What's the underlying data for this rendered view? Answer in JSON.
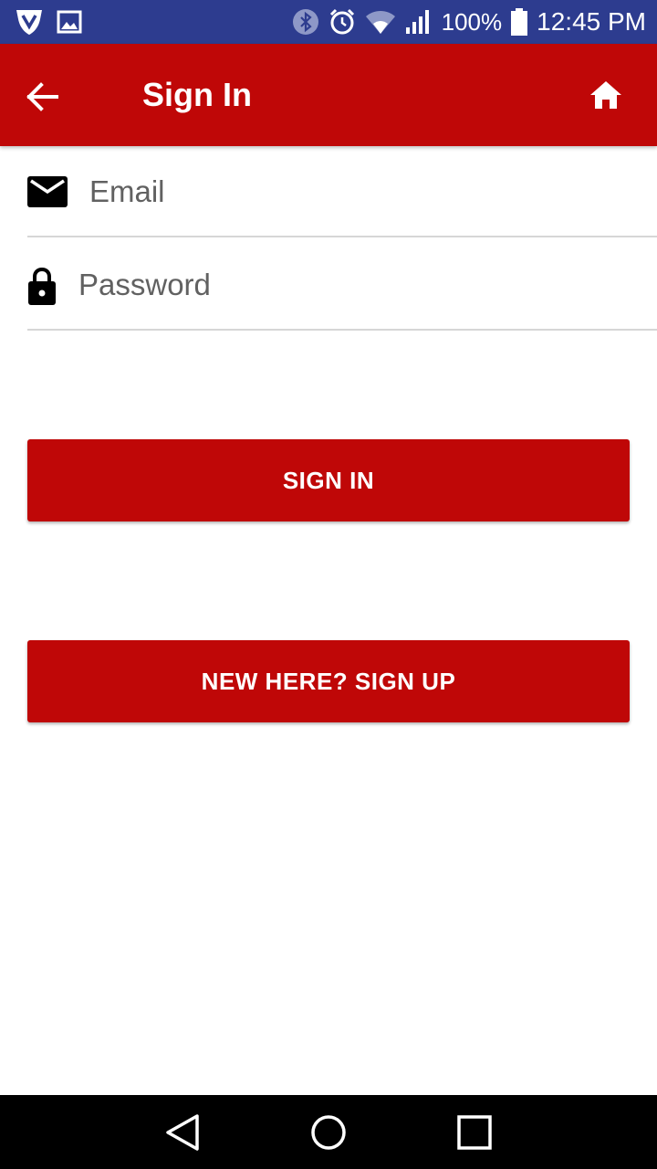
{
  "status_bar": {
    "battery_percent": "100%",
    "time": "12:45 PM",
    "icons": [
      "shield-icon",
      "image-icon",
      "bluetooth-icon",
      "alarm-icon",
      "wifi-icon",
      "signal-icon",
      "battery-icon"
    ]
  },
  "app_bar": {
    "title": "Sign In",
    "back_icon": "arrow-left-icon",
    "home_icon": "home-icon",
    "background_color": "#bf0707"
  },
  "form": {
    "email": {
      "placeholder": "Email",
      "value": "",
      "icon": "mail-icon"
    },
    "password": {
      "placeholder": "Password",
      "value": "",
      "icon": "lock-icon"
    }
  },
  "buttons": {
    "sign_in": "SIGN IN",
    "sign_up": "NEW HERE? SIGN UP"
  },
  "nav_bar": {
    "icons": [
      "back-triangle-icon",
      "home-circle-icon",
      "recents-square-icon"
    ]
  }
}
